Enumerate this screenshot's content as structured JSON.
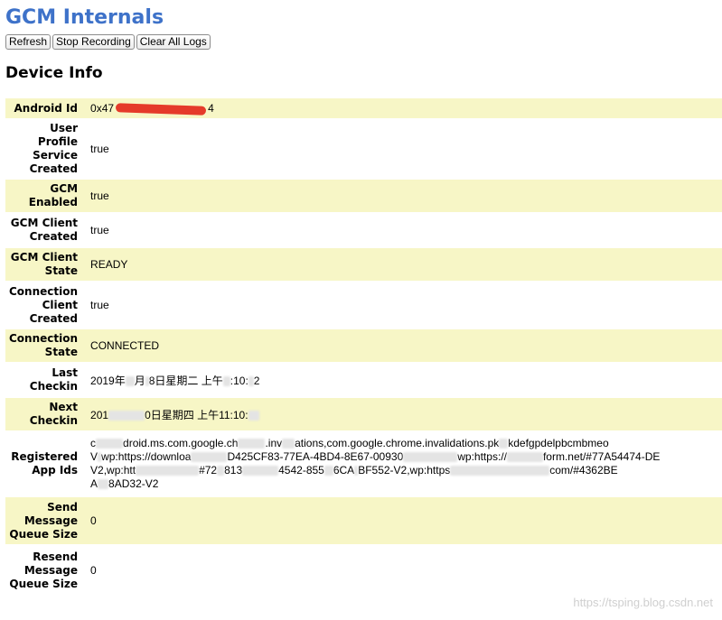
{
  "page": {
    "title": "GCM Internals",
    "buttons": {
      "refresh": "Refresh",
      "stop_recording": "Stop Recording",
      "clear_all_logs": "Clear All Logs"
    },
    "section_title": "Device Info"
  },
  "device_info": {
    "android_id": {
      "label": "Android Id",
      "value_prefix": "0x47",
      "value_suffix": "4"
    },
    "user_profile_service_created": {
      "label": "User Profile Service Created",
      "value": "true"
    },
    "gcm_enabled": {
      "label": "GCM Enabled",
      "value": "true"
    },
    "gcm_client_created": {
      "label": "GCM Client Created",
      "value": "true"
    },
    "gcm_client_state": {
      "label": "GCM Client State",
      "value": "READY"
    },
    "connection_client_created": {
      "label": "Connection Client Created",
      "value": "true"
    },
    "connection_state": {
      "label": "Connection State",
      "value": "CONNECTED"
    },
    "last_checkin": {
      "label": "Last Checkin",
      "value_a": "2019年",
      "value_b": "月",
      "value_c": "8日星期二 上午",
      "value_d": ":10:",
      "value_e": "2"
    },
    "next_checkin": {
      "label": "Next Checkin",
      "value_a": "201",
      "value_b": "0日星期四 上午11:10:"
    },
    "registered_app_ids": {
      "label": "Registered App Ids",
      "line1_a": "c",
      "line1_b": "droid.ms.com.google.ch",
      "line1_c": ".inv",
      "line1_d": "ations,com.google.chrome.invalidations.pk",
      "line1_e": "kdefgpdelpbcmbmeo",
      "line2_a": "V",
      "line2_b": "wp:https://downloa",
      "line2_c": "D425CF83-77EA-4BD4-8E67-00930",
      "line2_d": "wp:https://",
      "line2_e": "form.net/#77A54474-DE",
      "line3_a": "V2,wp:htt",
      "line3_b": "#72",
      "line3_c": "813",
      "line3_d": "4542-855",
      "line3_e": "6CA",
      "line3_f": "BF552-V2,wp:https",
      "line3_g": "com/#4362BE",
      "line4_a": "A",
      "line4_b": "8AD32-V2"
    },
    "send_message_queue_size": {
      "label": "Send Message Queue Size",
      "value": "0"
    },
    "resend_message_queue_size": {
      "label": "Resend Message Queue Size",
      "value": "0"
    }
  },
  "watermark": "https://tsping.blog.csdn.net",
  "colors": {
    "title": "#3e72c9",
    "odd_row": "#f7f6c6",
    "redaction": "#e53a2a"
  }
}
